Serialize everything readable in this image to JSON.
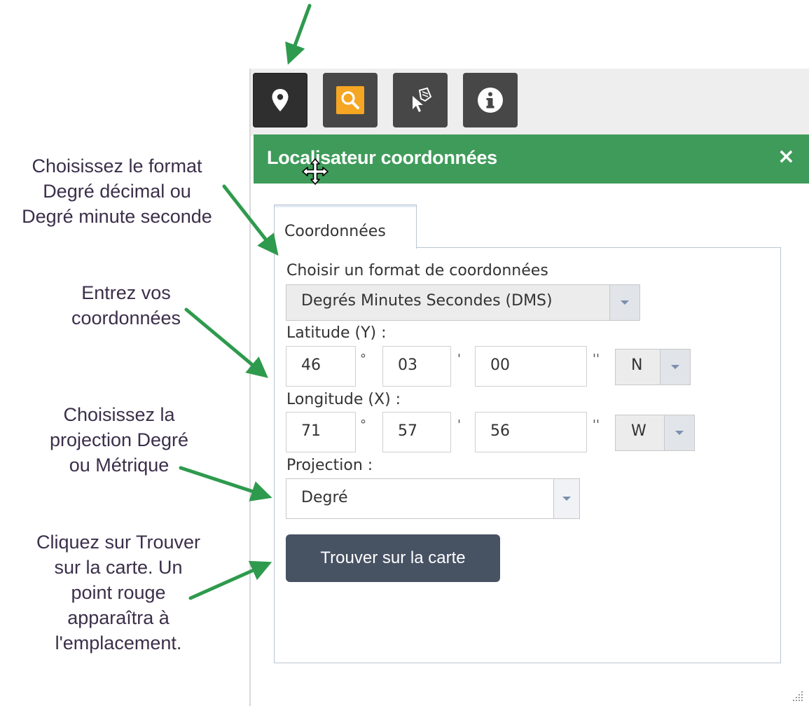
{
  "toolbar": {
    "buttons": [
      {
        "name": "location-pin-icon"
      },
      {
        "name": "search-icon",
        "accent": "#f5a623"
      },
      {
        "name": "select-identify-icon"
      },
      {
        "name": "info-icon"
      }
    ]
  },
  "panel": {
    "title": "Localisateur coordonnées",
    "close": "×",
    "header_color": "#3f9b5a"
  },
  "tab": {
    "label": "Coordonnées"
  },
  "form": {
    "format_label": "Choisir un format de coordonnées",
    "format_value": "Degrés Minutes Secondes (DMS)",
    "latitude_label": "Latitude (Y) :",
    "latitude": {
      "deg": "46",
      "min": "03",
      "sec": "00",
      "hemisphere": "N"
    },
    "longitude_label": "Longitude (X) :",
    "longitude": {
      "deg": "71",
      "min": "57",
      "sec": "56",
      "hemisphere": "W"
    },
    "units": {
      "deg": "°",
      "min": "'",
      "sec": "''"
    },
    "projection_label": "Projection :",
    "projection_value": "Degré",
    "find_button": "Trouver sur la carte",
    "find_button_color": "#475263"
  },
  "annotations": {
    "format": "Choisissez le format\nDegré décimal ou\nDegré minute seconde",
    "coords": "Entrez vos\ncoordonnées",
    "projection": "Choisissez la\nprojection Degré\nou Métrique",
    "find": "Cliquez sur Trouver\nsur la carte. Un\npoint rouge\napparaîtra à\nl'emplacement.",
    "arrow_color": "#2e9a4d"
  }
}
